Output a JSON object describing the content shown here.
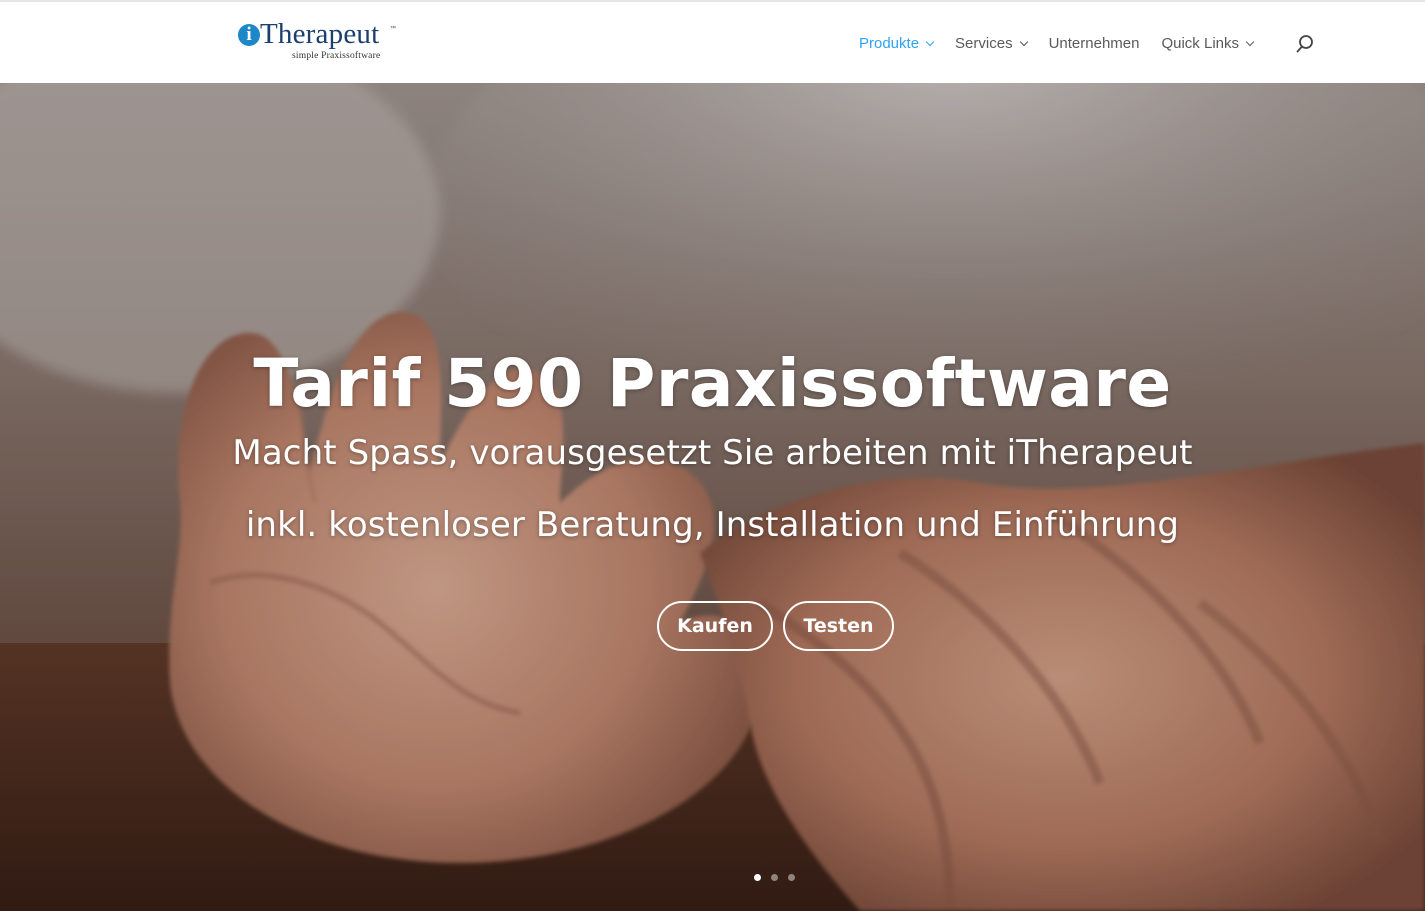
{
  "header": {
    "logo": {
      "letter": "i",
      "word": "Therapeut",
      "trademark": "™",
      "tagline": "simple Praxissoftware"
    },
    "nav": [
      {
        "label": "Produkte",
        "has_dropdown": true,
        "active": true
      },
      {
        "label": "Services",
        "has_dropdown": true,
        "active": false
      },
      {
        "label": "Unternehmen",
        "has_dropdown": false,
        "active": false
      },
      {
        "label": "Quick Links",
        "has_dropdown": true,
        "active": false
      }
    ],
    "search_icon": "search-icon"
  },
  "hero": {
    "title": "Tarif 590 Praxissoftware",
    "subtitle": "Macht Spass, vorausgesetzt Sie arbeiten mit iTherapeut",
    "subtitle2": "inkl. kostenloser Beratung, Installation und Einführung",
    "buttons": {
      "buy": "Kaufen",
      "test": "Testen"
    },
    "slides": {
      "count": 3,
      "active": 1
    }
  },
  "colors": {
    "accent": "#2ea3f2",
    "nav_text": "#5a5a5a",
    "logo_blue": "#1e87c8",
    "logo_navy": "#1c3f6e"
  }
}
